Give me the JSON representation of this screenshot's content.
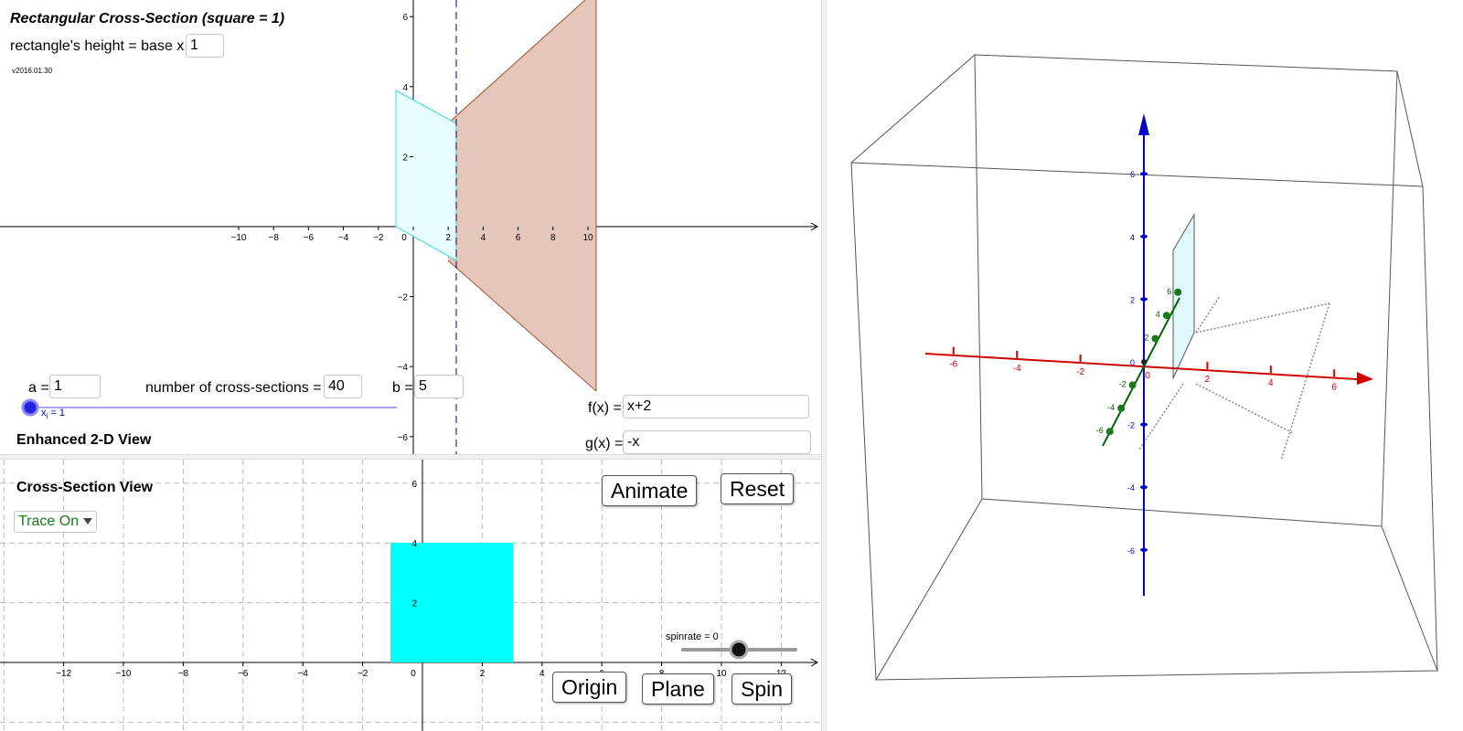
{
  "top_view": {
    "title": "Rectangular Cross-Section  (square = 1)",
    "height_label": "rectangle's height = base x",
    "height_value": "1",
    "version": "v2016.01.30",
    "a_label": "a =",
    "a_value": "1",
    "n_label": "number of cross-sections =",
    "n_value": "40",
    "b_label": "b =",
    "b_value": "5",
    "slider_label_base": "x",
    "slider_label_sub": "i",
    "slider_label_rest": " = 1",
    "fx_label": "f(x) =",
    "fx_value": "x+2",
    "gx_label": "g(x) =",
    "gx_value": "-x",
    "view_label": "Enhanced 2-D View",
    "x_ticks": [
      "−10",
      "−8",
      "−6",
      "−4",
      "−2",
      "0",
      "2",
      "4",
      "6",
      "8",
      "10"
    ],
    "y_ticks": [
      "6",
      "4",
      "2",
      "−2",
      "−4",
      "−6"
    ]
  },
  "bottom_view": {
    "title": "Cross-Section View",
    "trace_value": "Trace On",
    "animate_label": "Animate",
    "reset_label": "Reset",
    "origin_label": "Origin",
    "plane_label": "Plane",
    "spin_label": "Spin",
    "spinrate_label": "spinrate = 0",
    "spinrate_value": 0,
    "x_ticks": [
      "−12",
      "−10",
      "−8",
      "−6",
      "−4",
      "−2",
      "0",
      "2",
      "4",
      "6",
      "8",
      "10",
      "12"
    ],
    "y_ticks": [
      "6",
      "4",
      "2"
    ]
  },
  "view_3d": {
    "x_ticks": [
      "-6",
      "-4",
      "-2",
      "0",
      "2",
      "4",
      "6"
    ],
    "z_ticks": [
      "6",
      "4",
      "2",
      "0",
      "-2",
      "-4",
      "-6"
    ],
    "y_ticks": [
      "6",
      "4",
      "2",
      "-2",
      "-4",
      "-6"
    ]
  },
  "colors": {
    "cyan": "#00ffff",
    "region": "#e4c6ba",
    "region_edge": "#a0522d",
    "axis_red": "#cc0000",
    "axis_blue": "#0000cc",
    "axis_green": "#006400"
  }
}
